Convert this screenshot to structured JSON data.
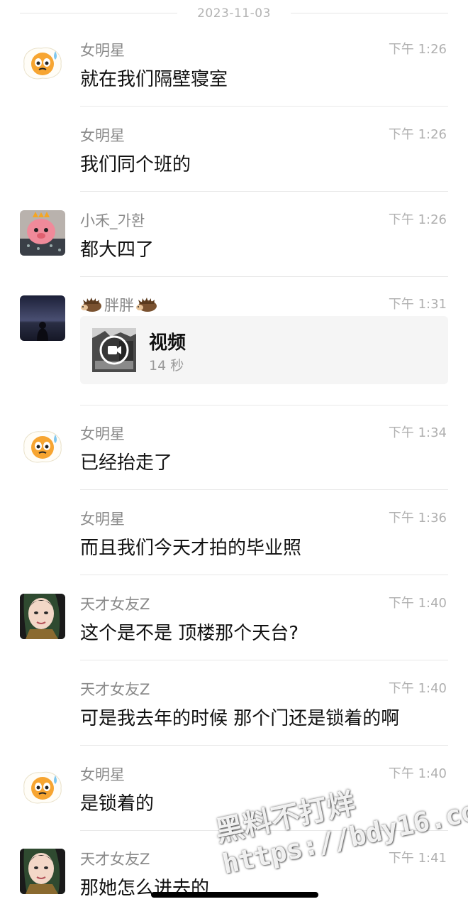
{
  "date_divider": "2023-11-03",
  "messages": [
    {
      "sender": "女明星",
      "time": "下午 1:26",
      "text": "就在我们隔壁寝室",
      "avatar": "egg-avatar"
    },
    {
      "sender": "女明星",
      "time": "下午 1:26",
      "text": "我们同个班的"
    },
    {
      "sender": "小禾_가환",
      "time": "下午 1:26",
      "text": "都大四了",
      "avatar": "pink-character-avatar"
    },
    {
      "sender": "胖胖",
      "time": "下午 1:31",
      "avatar": "night-silhouette-avatar",
      "video": {
        "title": "视频",
        "duration": "14 秒"
      }
    },
    {
      "sender": "女明星",
      "time": "下午 1:34",
      "text": "已经抬走了",
      "avatar": "egg-avatar"
    },
    {
      "sender": "女明星",
      "time": "下午 1:36",
      "text": "而且我们今天才拍的毕业照"
    },
    {
      "sender": "天才女友Z",
      "time": "下午 1:40",
      "text": "这个是不是 顶楼那个天台?",
      "avatar": "girl-photo-avatar"
    },
    {
      "sender": "天才女友Z",
      "time": "下午 1:40",
      "text": "可是我去年的时候 那个门还是锁着的啊"
    },
    {
      "sender": "女明星",
      "time": "下午 1:40",
      "text": "是锁着的",
      "avatar": "egg-avatar"
    },
    {
      "sender": "天才女友Z",
      "time": "下午 1:41",
      "text": "那她怎么进去的",
      "avatar": "girl-photo-avatar"
    }
  ],
  "watermark": {
    "line1": "黑料不打烊",
    "line2": "https://bdy16.co"
  }
}
